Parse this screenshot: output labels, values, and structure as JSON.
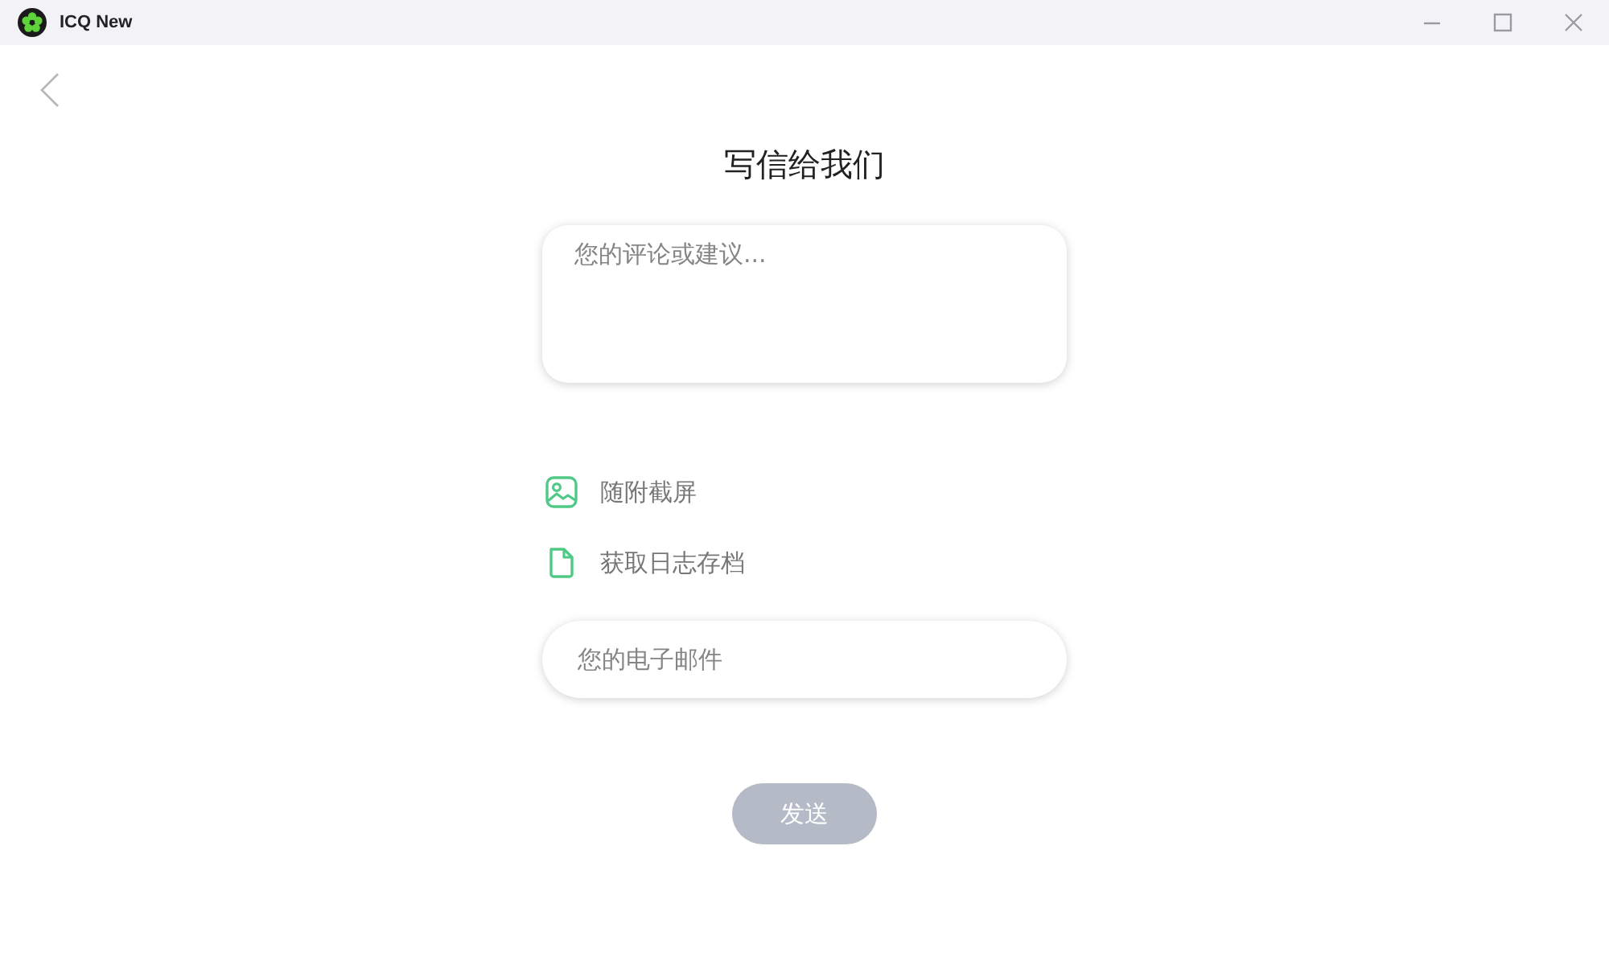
{
  "window": {
    "title": "ICQ New"
  },
  "page": {
    "title": "写信给我们"
  },
  "feedback_field": {
    "placeholder": "您的评论或建议..."
  },
  "options": [
    {
      "kind": "screenshot",
      "label": "随附截屏"
    },
    {
      "kind": "log",
      "label": "获取日志存档"
    }
  ],
  "email_field": {
    "placeholder": "您的电子邮件"
  },
  "send_button": {
    "label": "发送",
    "disabled": true
  }
}
